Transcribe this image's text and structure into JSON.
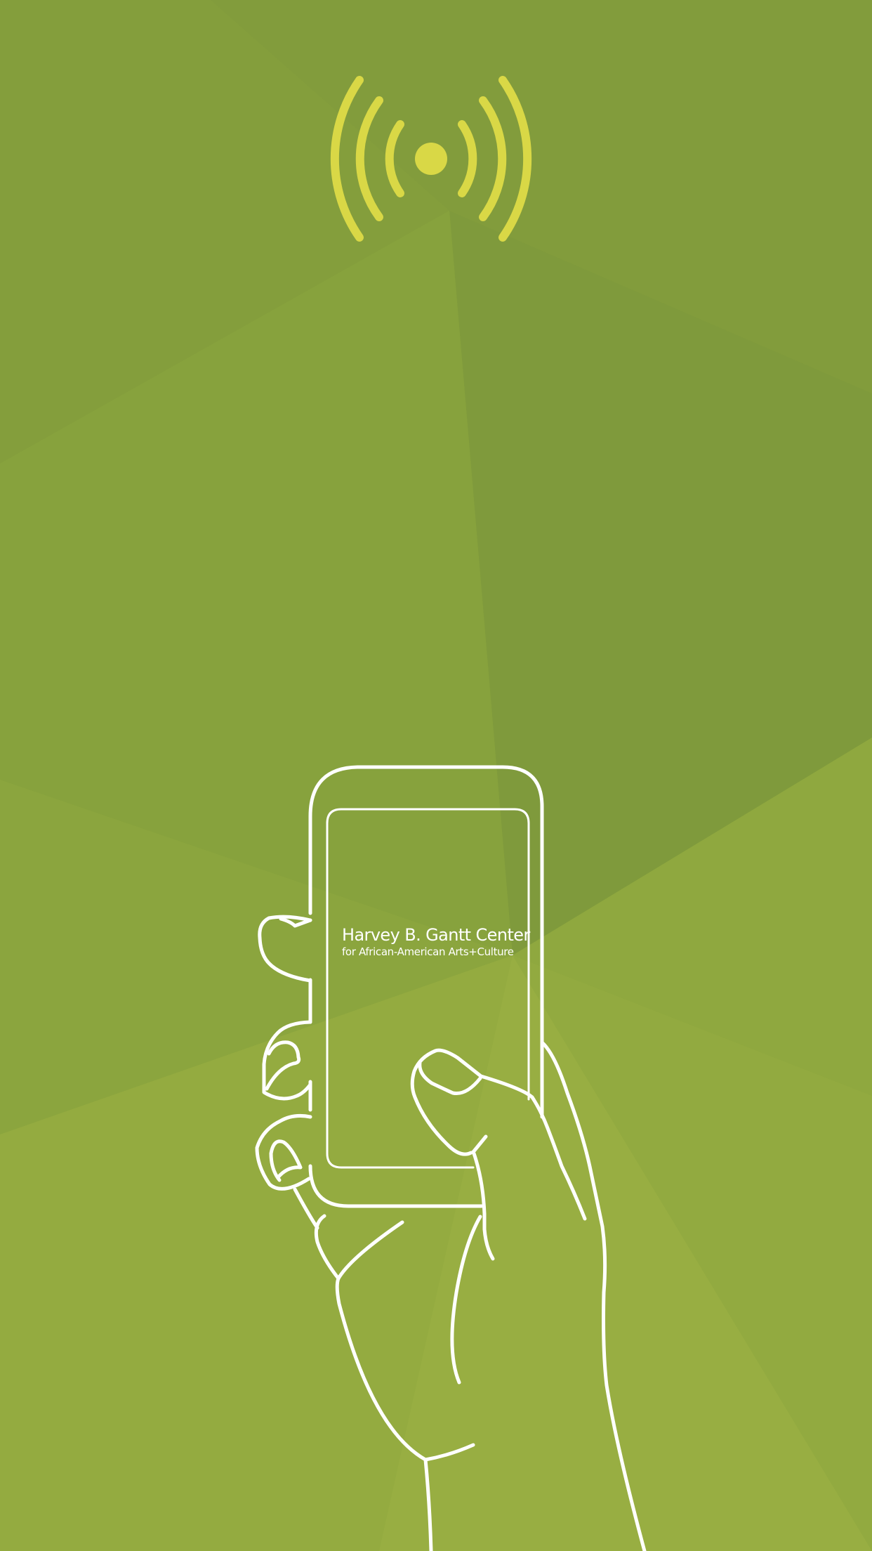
{
  "brand": {
    "title": "Harvey B. Gantt Center",
    "subtitle": "for African-American Arts+Culture"
  },
  "icons": {
    "signal": "wireless-broadcast-icon",
    "device": "smartphone-in-hand-illustration"
  },
  "colors": {
    "background": "#8aa43d",
    "signal": "#d9d846",
    "line": "#ffffff"
  }
}
